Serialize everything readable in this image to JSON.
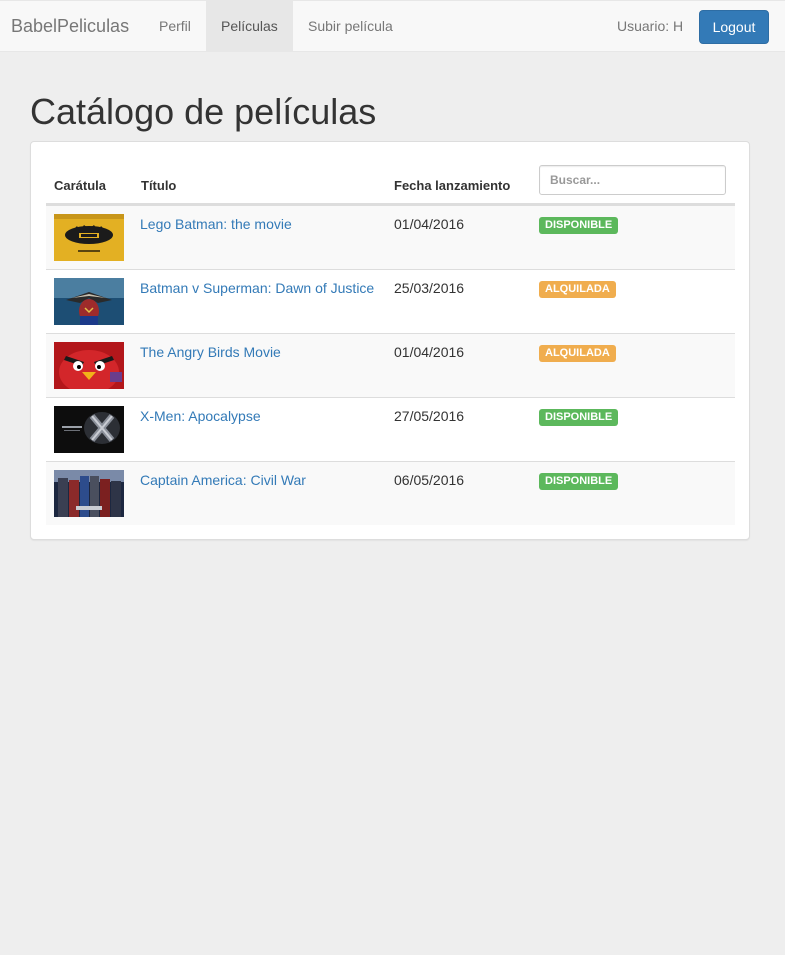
{
  "navbar": {
    "brand": "BabelPeliculas",
    "links": [
      {
        "label": "Perfil"
      },
      {
        "label": "Películas"
      },
      {
        "label": "Subir película"
      }
    ],
    "user_label": "Usuario: H",
    "logout_label": "Logout"
  },
  "page": {
    "title": "Catálogo de películas"
  },
  "table": {
    "headers": {
      "cover": "Carátula",
      "title": "Título",
      "release": "Fecha lanzamiento"
    },
    "search_placeholder": "Buscar...",
    "rows": [
      {
        "title": "Lego Batman: the movie",
        "date": "01/04/2016",
        "status": "DISPONIBLE"
      },
      {
        "title": "Batman v Superman: Dawn of Justice",
        "date": "25/03/2016",
        "status": "ALQUILADA"
      },
      {
        "title": "The Angry Birds Movie",
        "date": "01/04/2016",
        "status": "ALQUILADA"
      },
      {
        "title": "X-Men: Apocalypse",
        "date": "27/05/2016",
        "status": "DISPONIBLE"
      },
      {
        "title": "Captain America: Civil War",
        "date": "06/05/2016",
        "status": "DISPONIBLE"
      }
    ]
  },
  "colors": {
    "primary": "#337ab7",
    "success": "#5cb85c",
    "warning": "#f0ad4e"
  }
}
